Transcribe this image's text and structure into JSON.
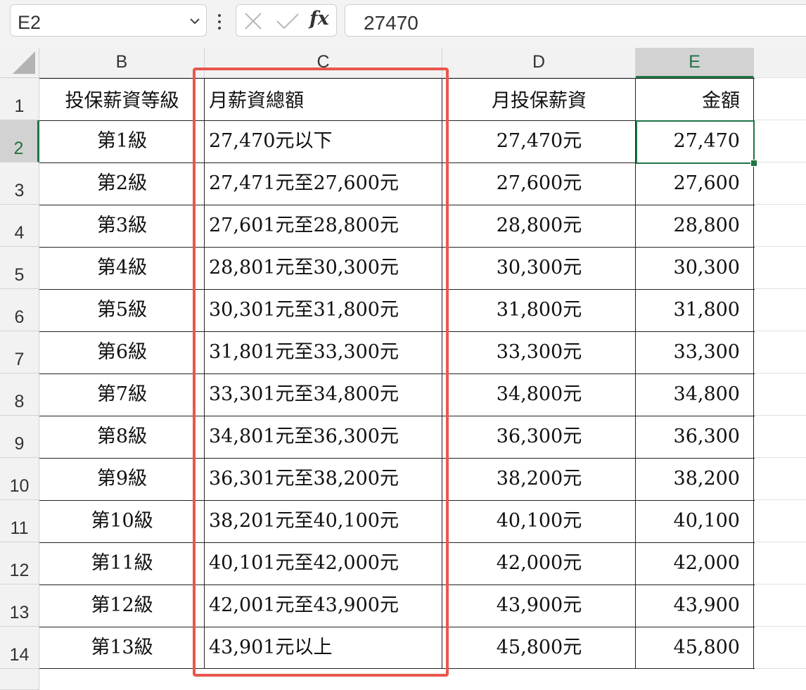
{
  "formula_bar": {
    "name_box": "E2",
    "fx_label": "fx",
    "formula_value": "27470"
  },
  "columns": [
    "B",
    "C",
    "D",
    "E"
  ],
  "selected_column": "E",
  "selected_row": "2",
  "rows": [
    "1",
    "2",
    "3",
    "4",
    "5",
    "6",
    "7",
    "8",
    "9",
    "10",
    "11",
    "12",
    "13",
    "14"
  ],
  "table": {
    "headers": [
      "投保薪資等級",
      "月薪資總額",
      "月投保薪資",
      "金額"
    ],
    "body": [
      [
        "第1級",
        "27,470元以下",
        "27,470元",
        "27,470"
      ],
      [
        "第2級",
        "27,471元至27,600元",
        "27,600元",
        "27,600"
      ],
      [
        "第3級",
        "27,601元至28,800元",
        "28,800元",
        "28,800"
      ],
      [
        "第4級",
        "28,801元至30,300元",
        "30,300元",
        "30,300"
      ],
      [
        "第5級",
        "30,301元至31,800元",
        "31,800元",
        "31,800"
      ],
      [
        "第6級",
        "31,801元至33,300元",
        "33,300元",
        "33,300"
      ],
      [
        "第7級",
        "33,301元至34,800元",
        "34,800元",
        "34,800"
      ],
      [
        "第8級",
        "34,801元至36,300元",
        "36,300元",
        "36,300"
      ],
      [
        "第9級",
        "36,301元至38,200元",
        "38,200元",
        "38,200"
      ],
      [
        "第10級",
        "38,201元至40,100元",
        "40,100元",
        "40,100"
      ],
      [
        "第11級",
        "40,101元至42,000元",
        "42,000元",
        "42,000"
      ],
      [
        "第12級",
        "42,001元至43,900元",
        "43,900元",
        "43,900"
      ],
      [
        "第13級",
        "43,901元以上",
        "45,800元",
        "45,800"
      ]
    ]
  },
  "colors": {
    "excel_green": "#217346",
    "highlight_box": "#e8574d"
  },
  "icons": {
    "name_box_dropdown": "chevron-down-icon",
    "more": "vertical-dots-icon",
    "cancel": "close-icon",
    "enter": "check-icon",
    "corner": "select-all-triangle-icon"
  }
}
